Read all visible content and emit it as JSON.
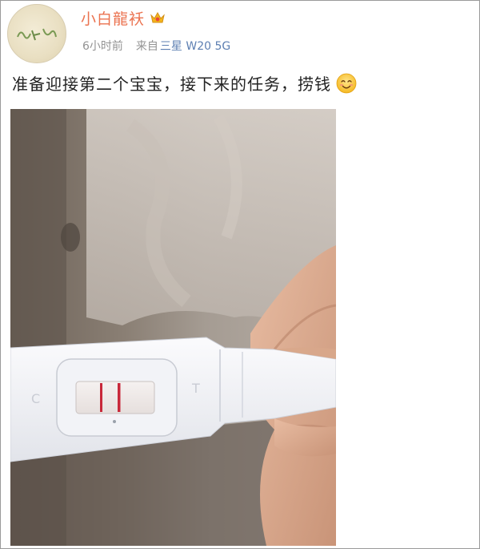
{
  "user": {
    "name": "小白龍袄",
    "badge_icon": "crown-badge-icon"
  },
  "meta": {
    "time": "6小时前",
    "source": "来自",
    "device": "三星 W20 5G"
  },
  "post": {
    "text": "准备迎接第二个宝宝，接下来的任务，捞钱",
    "emoji_icon": "smile-emoji-icon"
  },
  "photo": {
    "test_strip_letters": [
      "C",
      "T"
    ]
  },
  "colors": {
    "username": "#eb7350",
    "meta": "#939393",
    "device_link": "#5d7fb2",
    "positive_line": "#c8283a"
  }
}
